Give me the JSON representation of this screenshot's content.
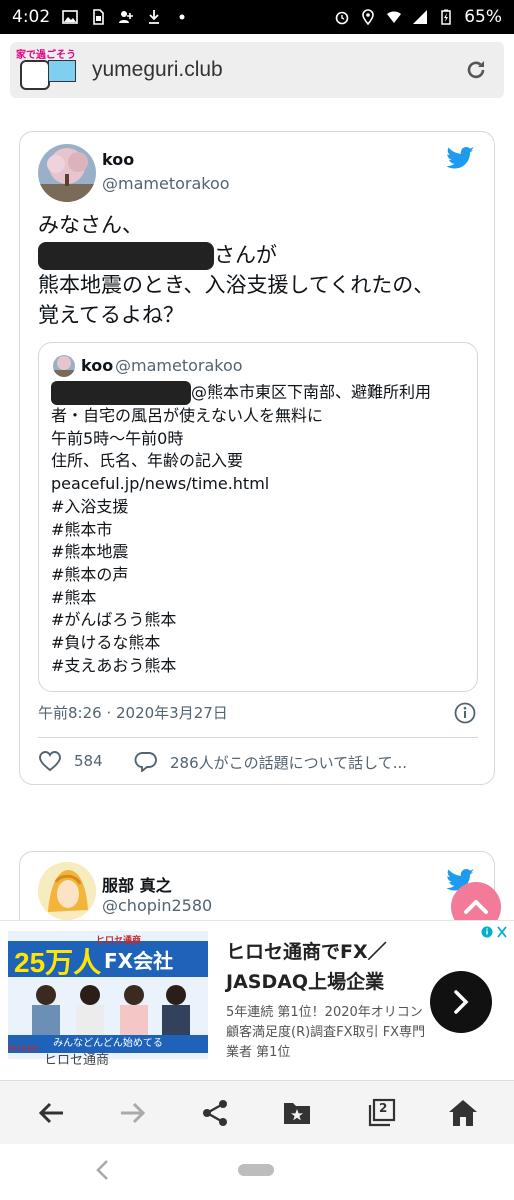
{
  "status_bar": {
    "time": "4:02",
    "battery": "65%"
  },
  "browser": {
    "site_logo_text": "家で過ごそう",
    "url": "yumeguri.club"
  },
  "tweet": {
    "author_name": "koo",
    "author_handle": "@mametorakoo",
    "body_line1": "みなさん、",
    "body_line2_suffix": "さんが",
    "body_line3": "熊本地震のとき、入浴支援してくれたの、",
    "body_line4": "覚えてるよね？",
    "quote": {
      "author_name": "koo",
      "author_handle": "@mametorakoo",
      "line1_suffix": "@熊本市東区下南部、避難所利用",
      "lines": [
        "者・自宅の風呂が使えない人を無料に",
        "午前5時〜午前0時",
        "住所、氏名、年齢の記入要",
        "peaceful.jp/news/time.html",
        "#入浴支援",
        "#熊本市",
        "#熊本地震",
        "#熊本の声",
        "#熊本",
        "#がんばろう熊本",
        "#負けるな熊本",
        "#支えあおう熊本"
      ]
    },
    "timestamp": "午前8:26 · 2020年3月27日",
    "like_count": "584",
    "reply_text": "286人がこの話題について話して..."
  },
  "tweet2": {
    "author_name": "服部 真之",
    "author_handle": "@chopin2580"
  },
  "ad": {
    "image_num": "25万人",
    "image_caption": "が選ぶ",
    "image_fx": "FX会社",
    "image_brand_small": "ヒロセ通商",
    "image_strip": "みんなどんどん始めてる",
    "brand_logo": "hirose",
    "brand": "ヒロセ通商",
    "headline": "ヒロセ通商でFX／JASDAQ上場企業",
    "desc": "5年連続 第1位！2020年オリコン顧客満足度(R)調査FX取引 FX専門業者 第1位"
  },
  "bottom_nav": {
    "tab_count": "2"
  },
  "colors": {
    "twitter_blue": "#1d9bf0",
    "scroll_top_pink": "#f37b9a",
    "ad_blue": "#1f62b9"
  }
}
